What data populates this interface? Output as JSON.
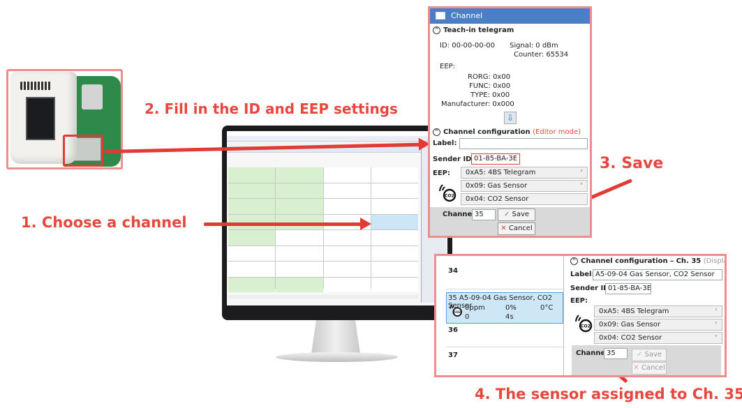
{
  "callouts": {
    "step1": "1. Choose a channel",
    "step2": "2. Fill in the ID and EEP settings",
    "step3": "3. Save",
    "step4": "4. The sensor assigned to Ch. 35"
  },
  "colors": {
    "callout": "#e8473f",
    "highlight": "#ef8c8c",
    "titlebar": "#4a7fc7",
    "selected": "#cde7f7"
  },
  "dialog": {
    "title": "Channel",
    "teach_in": {
      "header": "Teach-in telegram",
      "id_label": "ID:",
      "id_value": "00-00-00-00",
      "signal_label": "Signal:",
      "signal_value": "0 dBm",
      "counter_label": "Counter:",
      "counter_value": "65534",
      "eep_label": "EEP:",
      "rorg": "RORG: 0x00",
      "func": "FUNC: 0x00",
      "type": "TYPE: 0x00",
      "manufacturer": "Manufacturer: 0x000"
    },
    "config": {
      "header": "Channel configuration",
      "mode": "(Editor mode)",
      "label_label": "Label:",
      "label_value": "",
      "sender_label": "Sender ID:",
      "sender_value": "01-85-BA-3E",
      "eep_label": "EEP:",
      "eep_rorg": "0xA5: 4BS Telegram",
      "eep_func": "0x09: Gas Sensor",
      "eep_type": "0x04: CO2 Sensor",
      "channel_label": "Channel",
      "channel_value": "35",
      "save": "Save",
      "cancel": "Cancel"
    }
  },
  "zoom": {
    "rows": [
      "34",
      "36",
      "37"
    ],
    "selected": {
      "title": "35 A5-09-04 Gas Sensor, CO2 Sensor",
      "v1": "0ppm",
      "v2": "0%",
      "v3": "0°C",
      "v4": "0",
      "v5": "4s"
    },
    "config": {
      "header": "Channel configuration – Ch. 35",
      "mode": "(Display mode)",
      "label_label": "Label:",
      "label_value": "A5-09-04 Gas Sensor, CO2 Sensor",
      "sender_label": "Sender ID:",
      "sender_value": "01-85-BA-3E",
      "eep_label": "EEP:",
      "eep_rorg": "0xA5: 4BS Telegram",
      "eep_func": "0x09: Gas Sensor",
      "eep_type": "0x04: CO2 Sensor",
      "channel_label": "Channel",
      "channel_value": "35",
      "save": "Save",
      "cancel": "Cancel"
    }
  }
}
